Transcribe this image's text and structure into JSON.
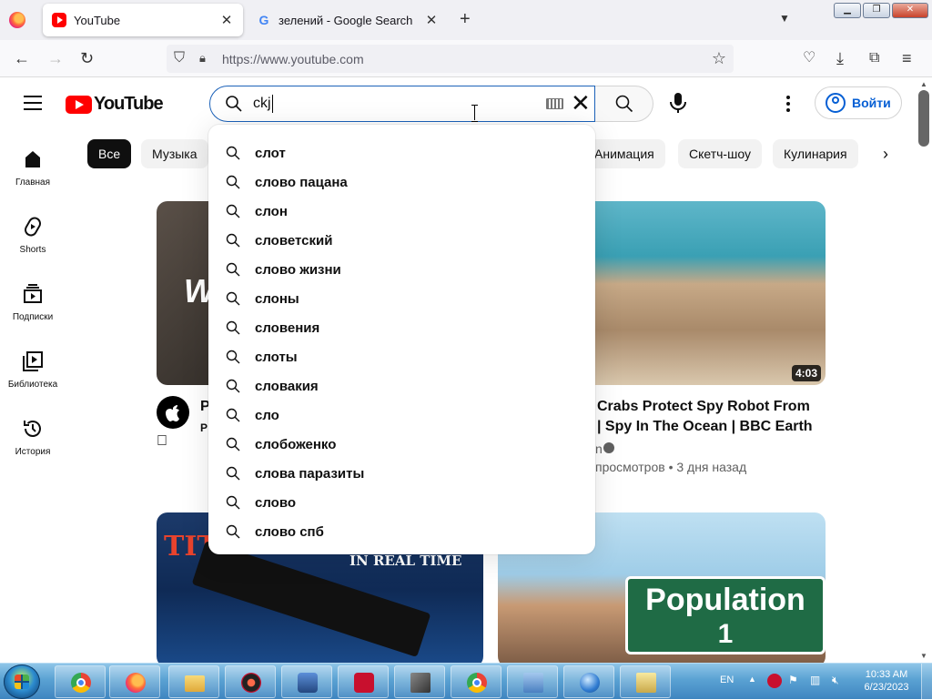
{
  "browser": {
    "tabs": [
      {
        "title": "YouTube",
        "icon": "youtube-favicon",
        "active": true
      },
      {
        "title": "зелений - Google Search",
        "icon": "google-favicon",
        "active": false
      }
    ],
    "url": "https://www.youtube.com",
    "accent": "#ff0000"
  },
  "youtube": {
    "logo_text": "YouTube",
    "search_query": "ckj",
    "suggestions": [
      "слот",
      "слово пацана",
      "слон",
      "словетский",
      "слово жизни",
      "слоны",
      "словения",
      "слоты",
      "словакия",
      "сло",
      "слобоженко",
      "слова паразиты",
      "слово",
      "слово спб"
    ],
    "signin_label": "Войти",
    "sidebar": [
      {
        "label": "Главная",
        "icon": "home-icon"
      },
      {
        "label": "Shorts",
        "icon": "shorts-icon"
      },
      {
        "label": "Подписки",
        "icon": "subscriptions-icon"
      },
      {
        "label": "Библиотека",
        "icon": "library-icon"
      },
      {
        "label": "История",
        "icon": "history-icon"
      }
    ],
    "chips": [
      "Все",
      "Музыка",
      "Анимация",
      "Скетч-шоу",
      "Кулинария"
    ],
    "videos": {
      "v1": {
        "title_fragment": "P",
        "channel_fragment": "P"
      },
      "v2": {
        "title_line1": "Crabs Protect Spy Robot From",
        "title_line2": "| Spy In The Ocean | BBC Earth",
        "channel_fragment": "n",
        "meta": "просмотров • 3 дня назад",
        "duration": "4:03"
      },
      "v3": {
        "thumb_text_1": "TIT",
        "thumb_text_2": "IN REAL TIME"
      },
      "v4": {
        "sign_line1": "Population",
        "sign_line2": "1"
      },
      "v1_thumb_text": "W"
    }
  },
  "taskbar": {
    "apps": [
      "chrome",
      "firefox",
      "explorer",
      "app-red",
      "app-blue",
      "screen-recorder",
      "app-box",
      "chrome",
      "control-panel",
      "network-globe",
      "keyboard-app"
    ],
    "lang": "EN",
    "time": "10:33 AM",
    "date": "6/23/2023"
  }
}
